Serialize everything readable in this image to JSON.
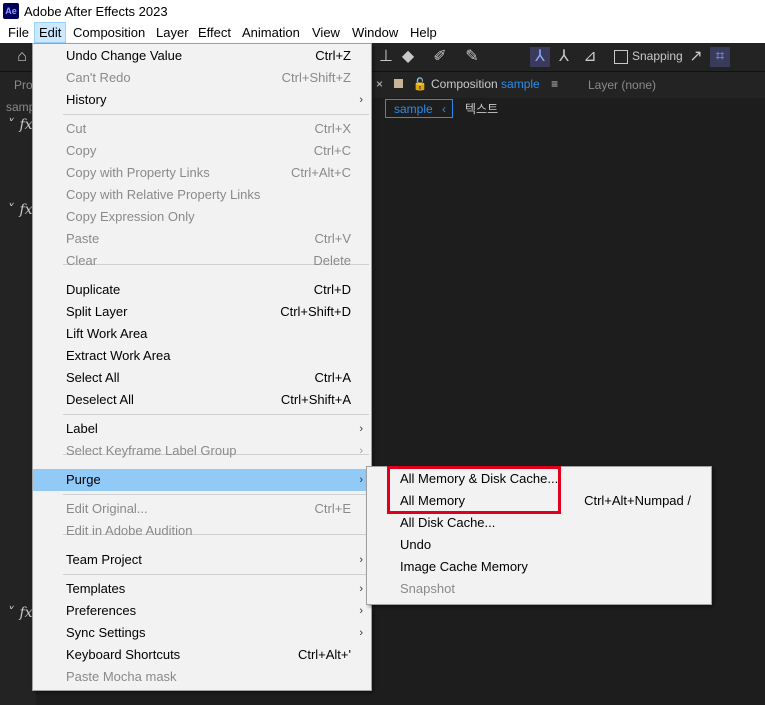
{
  "window": {
    "title": "Adobe After Effects 2023",
    "logo": "Ae"
  },
  "menubar": [
    "File",
    "Edit",
    "Composition",
    "Layer",
    "Effect",
    "Animation",
    "View",
    "Window",
    "Help"
  ],
  "toolbar": {
    "snapping_label": "Snapping"
  },
  "panels": {
    "composition_tab_prefix": "Composition",
    "composition_tab_name": "sample",
    "layer_tab": "Layer (none)",
    "subtab_active": "sample",
    "subtab_other": "텍스트",
    "left_fragments": [
      "Pro",
      "samp"
    ]
  },
  "edit_menu": [
    {
      "label": "Undo Change Value",
      "shortcut": "Ctrl+Z",
      "disabled": false
    },
    {
      "label": "Can't Redo",
      "shortcut": "Ctrl+Shift+Z",
      "disabled": true
    },
    {
      "label": "History",
      "shortcut": "",
      "disabled": false
    },
    {
      "label": "Cut",
      "shortcut": "Ctrl+X",
      "disabled": true
    },
    {
      "label": "Copy",
      "shortcut": "Ctrl+C",
      "disabled": true
    },
    {
      "label": "Copy with Property Links",
      "shortcut": "Ctrl+Alt+C",
      "disabled": true
    },
    {
      "label": "Copy with Relative Property Links",
      "shortcut": "",
      "disabled": true
    },
    {
      "label": "Copy Expression Only",
      "shortcut": "",
      "disabled": true
    },
    {
      "label": "Paste",
      "shortcut": "Ctrl+V",
      "disabled": true
    },
    {
      "label": "Clear",
      "shortcut": "Delete",
      "disabled": true
    },
    {
      "label": "Duplicate",
      "shortcut": "Ctrl+D",
      "disabled": false
    },
    {
      "label": "Split Layer",
      "shortcut": "Ctrl+Shift+D",
      "disabled": false
    },
    {
      "label": "Lift Work Area",
      "shortcut": "",
      "disabled": false
    },
    {
      "label": "Extract Work Area",
      "shortcut": "",
      "disabled": false
    },
    {
      "label": "Select All",
      "shortcut": "Ctrl+A",
      "disabled": false
    },
    {
      "label": "Deselect All",
      "shortcut": "Ctrl+Shift+A",
      "disabled": false
    },
    {
      "label": "Label",
      "shortcut": "",
      "disabled": false
    },
    {
      "label": "Select Keyframe Label Group",
      "shortcut": "",
      "disabled": true
    },
    {
      "label": "Purge",
      "shortcut": "",
      "disabled": false
    },
    {
      "label": "Edit Original...",
      "shortcut": "Ctrl+E",
      "disabled": true
    },
    {
      "label": "Edit in Adobe Audition",
      "shortcut": "",
      "disabled": true
    },
    {
      "label": "Team Project",
      "shortcut": "",
      "disabled": false
    },
    {
      "label": "Templates",
      "shortcut": "",
      "disabled": false
    },
    {
      "label": "Preferences",
      "shortcut": "",
      "disabled": false
    },
    {
      "label": "Sync Settings",
      "shortcut": "",
      "disabled": false
    },
    {
      "label": "Keyboard Shortcuts",
      "shortcut": "Ctrl+Alt+'",
      "disabled": false
    },
    {
      "label": "Paste Mocha mask",
      "shortcut": "",
      "disabled": true
    }
  ],
  "purge_menu": [
    {
      "label": "All Memory & Disk Cache...",
      "shortcut": "",
      "disabled": false
    },
    {
      "label": "All Memory",
      "shortcut": "Ctrl+Alt+Numpad /",
      "disabled": false
    },
    {
      "label": "All Disk Cache...",
      "shortcut": "",
      "disabled": false
    },
    {
      "label": "Undo",
      "shortcut": "",
      "disabled": false
    },
    {
      "label": "Image Cache Memory",
      "shortcut": "",
      "disabled": false
    },
    {
      "label": "Snapshot",
      "shortcut": "",
      "disabled": true
    }
  ],
  "colors": {
    "highlight": "#91c9f7",
    "annotation": "#e0001b",
    "accent": "#2d8ceb"
  }
}
